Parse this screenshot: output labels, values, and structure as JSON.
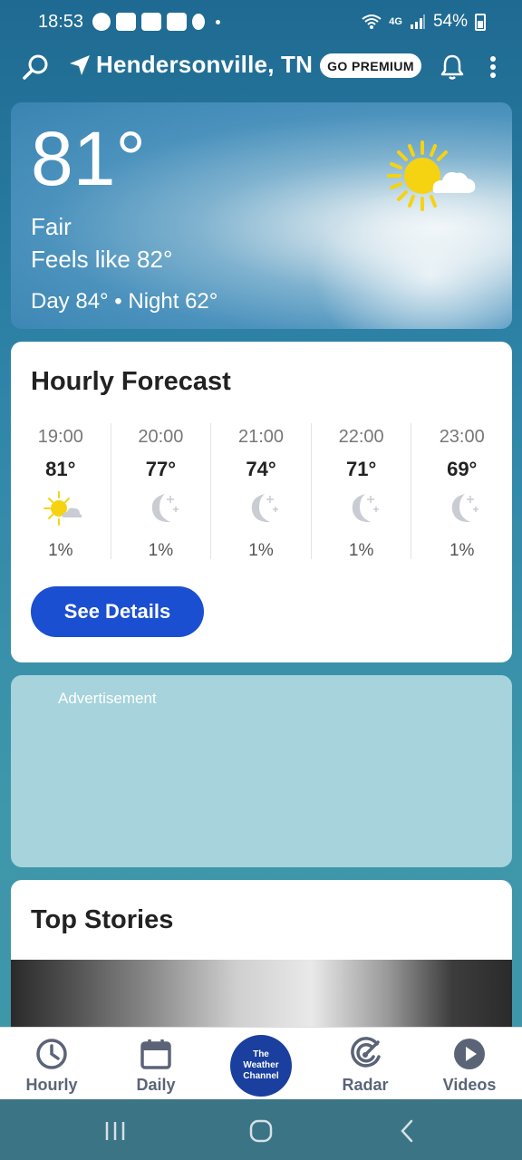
{
  "status_bar": {
    "time": "18:53",
    "battery": "54%",
    "network": "4G"
  },
  "header": {
    "location": "Hendersonville, TN",
    "premium_label": "GO PREMIUM"
  },
  "current": {
    "temperature": "81°",
    "condition": "Fair",
    "feels_like": "Feels like 82°",
    "day_night": "Day 84° • Night 62°",
    "icon": "sun-with-cloud-icon"
  },
  "hourly": {
    "title": "Hourly Forecast",
    "items": [
      {
        "time": "19:00",
        "temp": "81°",
        "precip": "1%",
        "icon": "sun-with-cloud-icon"
      },
      {
        "time": "20:00",
        "temp": "77°",
        "precip": "1%",
        "icon": "moon-icon"
      },
      {
        "time": "21:00",
        "temp": "74°",
        "precip": "1%",
        "icon": "moon-icon"
      },
      {
        "time": "22:00",
        "temp": "71°",
        "precip": "1%",
        "icon": "moon-icon"
      },
      {
        "time": "23:00",
        "temp": "69°",
        "precip": "1%",
        "icon": "moon-icon"
      }
    ],
    "details_label": "See Details"
  },
  "ad": {
    "label": "Advertisement"
  },
  "stories": {
    "title": "Top Stories"
  },
  "bottom_nav": {
    "items": [
      {
        "label": "Hourly",
        "icon": "clock-icon"
      },
      {
        "label": "Daily",
        "icon": "calendar-icon"
      },
      {
        "label": "Radar",
        "icon": "radar-icon"
      },
      {
        "label": "Videos",
        "icon": "play-icon"
      }
    ],
    "logo_lines": [
      "The",
      "Weather",
      "Channel"
    ]
  },
  "colors": {
    "accent_button": "#1a4fd1",
    "logo_bg": "#1a3f9e",
    "nav_text": "#5b6477",
    "sun": "#f5d312"
  }
}
